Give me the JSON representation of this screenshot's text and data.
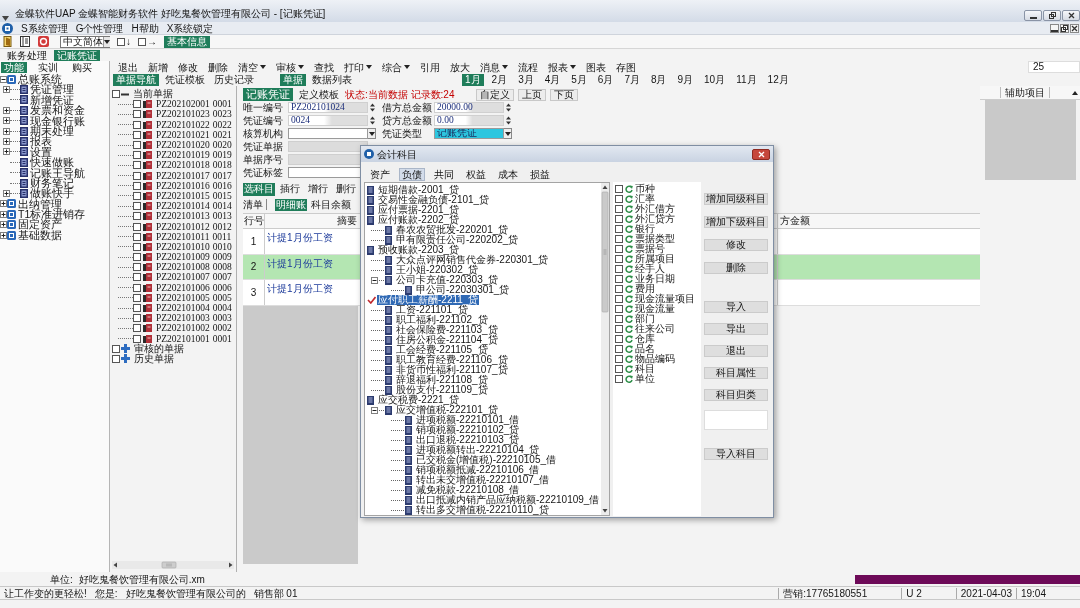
{
  "window": {
    "title": "金蝶软件UAP 金蝶智能财务软件 好吃鬼餐饮管理有限公司 - [记账凭证]"
  },
  "menu": [
    {
      "label": "S系统管理"
    },
    {
      "label": "G个性管理"
    },
    {
      "label": "H帮助"
    },
    {
      "label": "X系统锁定"
    }
  ],
  "toolbar": {
    "language": "中文简体",
    "toggles": [
      {
        "label": "↓",
        "checked": false
      },
      {
        "label": "→",
        "checked": false
      }
    ],
    "info_button": "基本信息"
  },
  "module_tabs": [
    {
      "label": "账务处理",
      "selected": false
    },
    {
      "label": "记账凭证",
      "selected": true
    }
  ],
  "sidebar": {
    "tabs": [
      {
        "label": "功能",
        "selected": true
      },
      {
        "label": "实训",
        "selected": false
      },
      {
        "label": "购买",
        "selected": false
      }
    ],
    "tree": [
      {
        "label": "总账系统",
        "expanded": true,
        "children": [
          {
            "label": "凭证管理",
            "expandable": true
          },
          {
            "label": "新增凭证",
            "expandable": false
          },
          {
            "label": "发票和资金",
            "expandable": true
          },
          {
            "label": "现金银行账",
            "expandable": true
          },
          {
            "label": "期末处理",
            "expandable": true
          },
          {
            "label": "报表",
            "expandable": true
          },
          {
            "label": "设置",
            "expandable": true
          },
          {
            "label": "快速做账",
            "expandable": false
          },
          {
            "label": "记账王导航",
            "expandable": false
          },
          {
            "label": "财务笔记",
            "expandable": false
          },
          {
            "label": "做账快手",
            "expandable": true
          }
        ]
      },
      {
        "label": "出纳管理",
        "expanded": false
      },
      {
        "label": "T1标准进销存",
        "expanded": false
      },
      {
        "label": "固定资产",
        "expanded": false
      },
      {
        "label": "基础数据",
        "expanded": false
      }
    ]
  },
  "actions": [
    {
      "label": "退出",
      "dropdown": false
    },
    {
      "label": "新增",
      "dropdown": false
    },
    {
      "label": "修改",
      "dropdown": false
    },
    {
      "label": "删除",
      "dropdown": false
    },
    {
      "label": "清空",
      "dropdown": true
    },
    {
      "label": "审核",
      "dropdown": true
    },
    {
      "label": "查找",
      "dropdown": false
    },
    {
      "label": "打印",
      "dropdown": true
    },
    {
      "label": "综合",
      "dropdown": true
    },
    {
      "label": "引用",
      "dropdown": false
    },
    {
      "label": "放大",
      "dropdown": false
    },
    {
      "label": "消息",
      "dropdown": true
    },
    {
      "label": "流程",
      "dropdown": false
    },
    {
      "label": "报表",
      "dropdown": true
    },
    {
      "label": "图表",
      "dropdown": false
    },
    {
      "label": "存图",
      "dropdown": false
    }
  ],
  "page_size": "25",
  "nav_tabs": [
    {
      "label": "单据导航",
      "selected": true
    },
    {
      "label": "凭证模板",
      "selected": false
    },
    {
      "label": "历史记录",
      "selected": false
    }
  ],
  "view_tabs": [
    {
      "label": "单据",
      "selected": true
    },
    {
      "label": "数据列表",
      "selected": false
    }
  ],
  "months": [
    {
      "label": "1月",
      "selected": true
    },
    {
      "label": "2月",
      "selected": false
    },
    {
      "label": "3月",
      "selected": false
    },
    {
      "label": "4月",
      "selected": false
    },
    {
      "label": "5月",
      "selected": false
    },
    {
      "label": "6月",
      "selected": false
    },
    {
      "label": "7月",
      "selected": false
    },
    {
      "label": "8月",
      "selected": false
    },
    {
      "label": "9月",
      "selected": false
    },
    {
      "label": "10月",
      "selected": false
    },
    {
      "label": "11月",
      "selected": false
    },
    {
      "label": "12月",
      "selected": false
    }
  ],
  "voucher_tree": [
    {
      "label": "当前单据",
      "checked": false,
      "expanded": true,
      "children": [
        {
          "number": "PZ202102001",
          "seq": "0001",
          "checked": false
        },
        {
          "number": "PZ202101023",
          "seq": "0023",
          "checked": false
        },
        {
          "number": "PZ202101022",
          "seq": "0022",
          "checked": false
        },
        {
          "number": "PZ202101021",
          "seq": "0021",
          "checked": false
        },
        {
          "number": "PZ202101020",
          "seq": "0020",
          "checked": false
        },
        {
          "number": "PZ202101019",
          "seq": "0019",
          "checked": false
        },
        {
          "number": "PZ202101018",
          "seq": "0018",
          "checked": false
        },
        {
          "number": "PZ202101017",
          "seq": "0017",
          "checked": false
        },
        {
          "number": "PZ202101016",
          "seq": "0016",
          "checked": false
        },
        {
          "number": "PZ202101015",
          "seq": "0015",
          "checked": false
        },
        {
          "number": "PZ202101014",
          "seq": "0014",
          "checked": false
        },
        {
          "number": "PZ202101013",
          "seq": "0013",
          "checked": false
        },
        {
          "number": "PZ202101012",
          "seq": "0012",
          "checked": false
        },
        {
          "number": "PZ202101011",
          "seq": "0011",
          "checked": false
        },
        {
          "number": "PZ202101010",
          "seq": "0010",
          "checked": false
        },
        {
          "number": "PZ202101009",
          "seq": "0009",
          "checked": false
        },
        {
          "number": "PZ202101008",
          "seq": "0008",
          "checked": false
        },
        {
          "number": "PZ202101007",
          "seq": "0007",
          "checked": false
        },
        {
          "number": "PZ202101006",
          "seq": "0006",
          "checked": false
        },
        {
          "number": "PZ202101005",
          "seq": "0005",
          "checked": false
        },
        {
          "number": "PZ202101004",
          "seq": "0004",
          "checked": false
        },
        {
          "number": "PZ202101003",
          "seq": "0003",
          "checked": false
        },
        {
          "number": "PZ202101002",
          "seq": "0002",
          "checked": false
        },
        {
          "number": "PZ202101001",
          "seq": "0001",
          "checked": false
        }
      ]
    },
    {
      "label": "审核的单据",
      "checked": false,
      "expanded": false
    },
    {
      "label": "历史单据",
      "checked": false,
      "expanded": false
    }
  ],
  "voucher": {
    "title": "记账凭证",
    "template_link": "定义模板",
    "status": "状态:当前数据 记录数:24",
    "page_buttons": [
      "自定义",
      "上页",
      "下页"
    ],
    "left_fields": [
      {
        "label": "唯一编号",
        "kind": "spin",
        "value": "PZ202101024",
        "highlighted": false
      },
      {
        "label": "凭证编号",
        "kind": "spin",
        "value": "0024",
        "highlighted": false
      },
      {
        "label": "核算机构",
        "kind": "dropdown",
        "highlighted": false
      },
      {
        "label": "凭证单据",
        "kind": "readonly",
        "highlighted": false
      },
      {
        "label": "单据序号",
        "kind": "readonly",
        "highlighted": false
      },
      {
        "label": "凭证标签",
        "kind": "text",
        "highlighted": false
      }
    ],
    "right_fields": [
      {
        "label": "借方总金额",
        "kind": "spin",
        "value": "20000.00",
        "highlighted": false
      },
      {
        "label": "贷方总金额",
        "kind": "spin",
        "value": "0.00",
        "highlighted": false
      },
      {
        "label": "凭证类型",
        "kind": "dropdown",
        "value": "记账凭证",
        "highlighted": true
      }
    ]
  },
  "grid_buttons": [
    {
      "label": "选科目",
      "kind": "primary"
    },
    {
      "label": "插行",
      "kind": "plain"
    },
    {
      "label": "增行",
      "kind": "plain"
    },
    {
      "label": "删行",
      "kind": "plain"
    }
  ],
  "detail": {
    "label": "清单",
    "tabs": [
      {
        "label": "明细账",
        "selected": true
      },
      {
        "label": "科目余额",
        "selected": false
      }
    ]
  },
  "table": {
    "columns": [
      "行号",
      "摘要",
      "方金额"
    ],
    "rows": [
      {
        "line": "1",
        "summary": "计提1月份工资",
        "selected": false
      },
      {
        "line": "2",
        "summary": "计提1月份工资",
        "selected": true
      },
      {
        "line": "3",
        "summary": "计提1月份工资",
        "selected": false
      }
    ]
  },
  "aux_panel": {
    "title": "辅助项目"
  },
  "dialog": {
    "title": "会计科目",
    "tabs": [
      {
        "label": "资产",
        "selected": false
      },
      {
        "label": "负债",
        "selected": true
      },
      {
        "label": "共同",
        "selected": false
      },
      {
        "label": "权益",
        "selected": false
      },
      {
        "label": "成本",
        "selected": false
      },
      {
        "label": "损益",
        "selected": false
      }
    ],
    "accounts": [
      {
        "label": "短期借款-2001_贷",
        "selected": false
      },
      {
        "label": "交易性金融负债-2101_贷",
        "selected": false
      },
      {
        "label": "应付票据-2201_贷",
        "selected": false
      },
      {
        "label": "应付账款-2202_贷",
        "selected": false,
        "children": [
          {
            "label": "春农农贸批发-220201_贷",
            "selected": false
          },
          {
            "label": "甲有限责任公司-220202_贷",
            "selected": false
          }
        ]
      },
      {
        "label": "预收账款-2203_贷",
        "selected": false,
        "children": [
          {
            "label": "大众点评网销售代金券-220301_贷",
            "selected": false
          },
          {
            "label": "王小姐-220302_贷",
            "selected": false
          },
          {
            "label": "公司卡充值-220303_贷",
            "selected": false,
            "children": [
              {
                "label": "甲公司-22030301_贷",
                "selected": false
              }
            ]
          }
        ]
      },
      {
        "label": "应付职工薪酬-2211_贷",
        "selected": true,
        "children": [
          {
            "label": "工资-221101_贷",
            "selected": false
          },
          {
            "label": "职工福利-221102_贷",
            "selected": false
          },
          {
            "label": "社会保险费-221103_贷",
            "selected": false
          },
          {
            "label": "住房公积金-221104_贷",
            "selected": false
          },
          {
            "label": "工会经费-221105_贷",
            "selected": false
          },
          {
            "label": "职工教育经费-221106_贷",
            "selected": false
          },
          {
            "label": "非货币性福利-221107_贷",
            "selected": false
          },
          {
            "label": "辞退福利-221108_贷",
            "selected": false
          },
          {
            "label": "股份支付-221109_贷",
            "selected": false
          }
        ]
      },
      {
        "label": "应交税费-2221_贷",
        "selected": false,
        "children": [
          {
            "label": "应交增值税-222101_贷",
            "selected": false,
            "children": [
              {
                "label": "进项税额-22210101_借",
                "selected": false
              },
              {
                "label": "销项税额-22210102_贷",
                "selected": false
              },
              {
                "label": "出口退税-22210103_贷",
                "selected": false
              },
              {
                "label": "进项税额转出-22210104_贷",
                "selected": false
              },
              {
                "label": "已交税金(增值税)-22210105_借",
                "selected": false
              },
              {
                "label": "销项税额抵减-22210106_借",
                "selected": false
              },
              {
                "label": "转出未交增值税-22210107_借",
                "selected": false
              },
              {
                "label": "减免税款-22210108_借",
                "selected": false
              },
              {
                "label": "出口抵减内销产品应纳税额-22210109_借",
                "selected": false
              },
              {
                "label": "转出多交增值税-22210110_贷",
                "selected": false
              }
            ]
          }
        ]
      }
    ],
    "attributes": [
      {
        "label": "币种",
        "checked": false
      },
      {
        "label": "汇率",
        "checked": false
      },
      {
        "label": "外汇借方",
        "checked": false
      },
      {
        "label": "外汇贷方",
        "checked": false
      },
      {
        "label": "银行",
        "checked": false
      },
      {
        "label": "票据类型",
        "checked": false
      },
      {
        "label": "票据号",
        "checked": false
      },
      {
        "label": "所属项目",
        "checked": false
      },
      {
        "label": "经手人",
        "checked": false
      },
      {
        "label": "业务日期",
        "checked": false
      },
      {
        "label": "费用",
        "checked": false
      },
      {
        "label": "现金流量项目",
        "checked": false
      },
      {
        "label": "现金流量",
        "checked": false
      },
      {
        "label": "部门",
        "checked": false
      },
      {
        "label": "往来公司",
        "checked": false
      },
      {
        "label": "仓库",
        "checked": false
      },
      {
        "label": "品名",
        "checked": false
      },
      {
        "label": "物品编码",
        "checked": false
      },
      {
        "label": "科目",
        "checked": false
      },
      {
        "label": "单位",
        "checked": false
      }
    ],
    "button_groups": [
      [
        "增加同级科目",
        "增加下级科目",
        "修改",
        "删除"
      ],
      [
        "导入",
        "导出",
        "退出",
        "科目属性",
        "科目归类"
      ],
      [
        "导入科目"
      ]
    ]
  },
  "unit": {
    "label": "单位:",
    "value": "好吃鬼餐饮管理有限公司.xm"
  },
  "status_bar": {
    "slogan": "让工作变的更轻松!",
    "user_label": "您是:",
    "company": "好吃鬼餐饮管理有限公司的",
    "role": "销售部 01",
    "hotline": "营销:17765180551",
    "user_count": "U 2",
    "date": "2021-04-03",
    "time": "19:04"
  }
}
